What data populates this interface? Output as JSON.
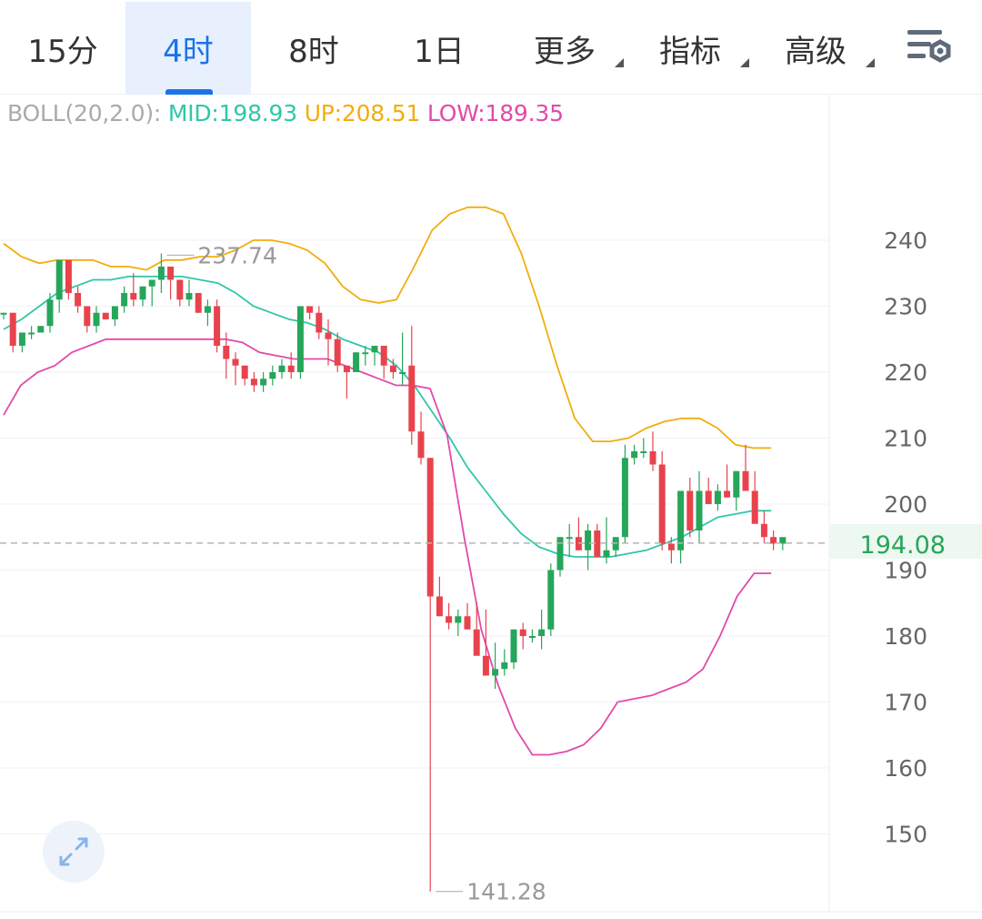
{
  "tabs": [
    {
      "label": "15分",
      "active": false,
      "dropdown": false
    },
    {
      "label": "4时",
      "active": true,
      "dropdown": false
    },
    {
      "label": "8时",
      "active": false,
      "dropdown": false
    },
    {
      "label": "1日",
      "active": false,
      "dropdown": false
    },
    {
      "label": "更多",
      "active": false,
      "dropdown": true
    },
    {
      "label": "指标",
      "active": false,
      "dropdown": true
    },
    {
      "label": "高级",
      "active": false,
      "dropdown": true
    }
  ],
  "settings_icon": "chart-settings-gear-icon",
  "expand_icon": "expand-arrows-icon",
  "indicator": {
    "label": "BOLL(20,2.0):",
    "mid": "MID:198.93",
    "up": "UP:208.51",
    "low": "LOW:189.35"
  },
  "colors": {
    "accent": "#1a73e8",
    "rise": "#26a65b",
    "fall": "#e8434d",
    "mid_line": "#2fc7a8",
    "up_line": "#f2ad0f",
    "low_line": "#e24aa9",
    "last_price": "#26a65b"
  },
  "chart_data": {
    "type": "candlestick",
    "indicator": "BOLL(20,2.0)",
    "y_ticks": [
      240,
      230,
      220,
      210,
      200,
      190,
      180,
      170,
      160,
      150
    ],
    "last_price": 194.08,
    "last_price_label": "194.08",
    "high_marker": {
      "value": 237.74,
      "label": "237.74"
    },
    "low_marker": {
      "value": 141.28,
      "label": "141.28"
    },
    "ohlc": [
      [
        229,
        229,
        228,
        229
      ],
      [
        229,
        229,
        223,
        224
      ],
      [
        224,
        226,
        223,
        226
      ],
      [
        226,
        227,
        225,
        226
      ],
      [
        226,
        227,
        226,
        227
      ],
      [
        227,
        232,
        226,
        231
      ],
      [
        231,
        237,
        229,
        237
      ],
      [
        237,
        237,
        231,
        232
      ],
      [
        232,
        233,
        229,
        230
      ],
      [
        230,
        230,
        226,
        227
      ],
      [
        227,
        230,
        226,
        229
      ],
      [
        229,
        229,
        228,
        228
      ],
      [
        228,
        230,
        227,
        230
      ],
      [
        230,
        233,
        229,
        232
      ],
      [
        232,
        235,
        230,
        231
      ],
      [
        231,
        233,
        230,
        233
      ],
      [
        233,
        234,
        230,
        234
      ],
      [
        234,
        238,
        232,
        236
      ],
      [
        236,
        236,
        231,
        234
      ],
      [
        234,
        234,
        230,
        231
      ],
      [
        231,
        234,
        230,
        232
      ],
      [
        232,
        232,
        229,
        229
      ],
      [
        229,
        231,
        227,
        230
      ],
      [
        230,
        231,
        223,
        224
      ],
      [
        224,
        226,
        219,
        222
      ],
      [
        222,
        223,
        218,
        221
      ],
      [
        221,
        221,
        218,
        219
      ],
      [
        219,
        220,
        217,
        218
      ],
      [
        218,
        220,
        217,
        219
      ],
      [
        219,
        221,
        218,
        220
      ],
      [
        220,
        222,
        219,
        221
      ],
      [
        221,
        223,
        219,
        220
      ],
      [
        220,
        230,
        219,
        230
      ],
      [
        230,
        230,
        228,
        229
      ],
      [
        229,
        230,
        225,
        226
      ],
      [
        226,
        228,
        221,
        225
      ],
      [
        225,
        226,
        220,
        221
      ],
      [
        221,
        221,
        216,
        220
      ],
      [
        220,
        223,
        220,
        223
      ],
      [
        223,
        224,
        221,
        223
      ],
      [
        223,
        224,
        221,
        224
      ],
      [
        224,
        224,
        219,
        221
      ],
      [
        221,
        222,
        219,
        220
      ],
      [
        220,
        226,
        218,
        220
      ],
      [
        221,
        227,
        209,
        211
      ],
      [
        211,
        214,
        206,
        207
      ],
      [
        207,
        207,
        141.28,
        186
      ],
      [
        186,
        189,
        183,
        183
      ],
      [
        183,
        185,
        181,
        182
      ],
      [
        182,
        184,
        180,
        183
      ],
      [
        183,
        185,
        181,
        181
      ],
      [
        181,
        185,
        180,
        177
      ],
      [
        177,
        184,
        177,
        174
      ],
      [
        174,
        179,
        172,
        175
      ],
      [
        175,
        178,
        174,
        176
      ],
      [
        176,
        181,
        175,
        181
      ],
      [
        181,
        182,
        178,
        180
      ],
      [
        180,
        181,
        179,
        180
      ],
      [
        180,
        184,
        178,
        181
      ],
      [
        181,
        191,
        180,
        190
      ],
      [
        190,
        195,
        189,
        195
      ],
      [
        195,
        197,
        192,
        195
      ],
      [
        195,
        198,
        193,
        193
      ],
      [
        193,
        197,
        190,
        196
      ],
      [
        196,
        197,
        193,
        192
      ],
      [
        192,
        198,
        191,
        193
      ],
      [
        193,
        195,
        192,
        195
      ],
      [
        195,
        209,
        194,
        207
      ],
      [
        207,
        209,
        206,
        208
      ],
      [
        208,
        210,
        207,
        208
      ],
      [
        208,
        211,
        205,
        206
      ],
      [
        206,
        208,
        193,
        194
      ],
      [
        194,
        195,
        191,
        193
      ],
      [
        193,
        202,
        191,
        202
      ],
      [
        202,
        204,
        195,
        196
      ],
      [
        196,
        205,
        194,
        202
      ],
      [
        202,
        204,
        200,
        200
      ],
      [
        200,
        203,
        199,
        202
      ],
      [
        202,
        206,
        201,
        201
      ],
      [
        201,
        205,
        199,
        205
      ],
      [
        205,
        209,
        203,
        202
      ],
      [
        202,
        205,
        198,
        197
      ],
      [
        197,
        199,
        194,
        195
      ],
      [
        195,
        196,
        193,
        194
      ],
      [
        194,
        195,
        193,
        195
      ]
    ],
    "boll": {
      "up": [
        239.5,
        237.5,
        236.5,
        237,
        237,
        237,
        236,
        236,
        235.5,
        237,
        237,
        237.5,
        237.5,
        238.5,
        240,
        240,
        239.5,
        238.5,
        236.5,
        233,
        231,
        230.5,
        231,
        236,
        241.5,
        244,
        245,
        245,
        244,
        238,
        230,
        221,
        213,
        209.5,
        209.5,
        210,
        211.5,
        212.5,
        213,
        213,
        211.5,
        209,
        208.5,
        208.5
      ],
      "mid": [
        226.5,
        228,
        230,
        232,
        233,
        234,
        234,
        234.5,
        234.5,
        234.5,
        234.5,
        234,
        233.5,
        232,
        230,
        229,
        228,
        227.5,
        226.5,
        225,
        224,
        223,
        221,
        218,
        214,
        210,
        205.5,
        202,
        198.5,
        195.5,
        193.5,
        192.5,
        192,
        192,
        192,
        192.5,
        193,
        194,
        195,
        196.5,
        198,
        198.5,
        199,
        199
      ],
      "low": [
        213.5,
        218,
        220,
        221,
        223,
        224,
        225,
        225,
        225,
        225,
        225,
        225,
        225,
        225,
        224.5,
        223,
        222.5,
        222,
        222,
        222,
        221,
        220,
        219,
        218,
        218,
        217.5,
        210.5,
        195,
        181,
        172.5,
        166,
        162,
        162,
        162.5,
        163.5,
        166,
        170,
        170.5,
        171,
        172,
        173,
        175,
        180,
        186,
        189.5,
        189.5
      ]
    }
  }
}
